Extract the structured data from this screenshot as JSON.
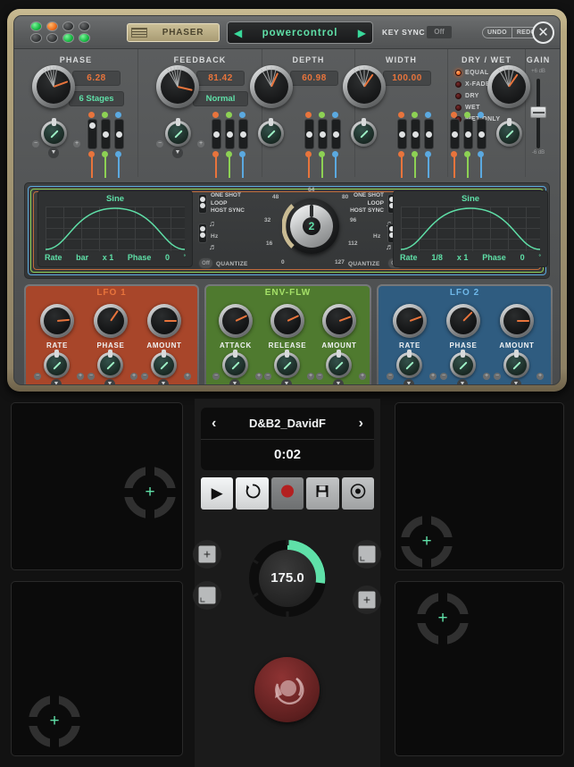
{
  "plugin": {
    "header": {
      "slot_name": "PHASER",
      "preset_name": "powercontrol",
      "prev_icon": "◀",
      "next_icon": "▶",
      "key_sync_label": "KEY SYNC",
      "key_sync_value": "Off",
      "undo_label": "UNDO",
      "redo_label": "REDO",
      "close_icon": "✕",
      "leds": [
        {
          "state": "green"
        },
        {
          "state": "orange"
        },
        {
          "state": "off"
        },
        {
          "state": "off"
        },
        {
          "state": "off"
        },
        {
          "state": "off"
        },
        {
          "state": "green"
        },
        {
          "state": "green"
        }
      ]
    },
    "params": [
      {
        "label": "PHASE",
        "value": "6.28",
        "mode": "6 Stages",
        "angle": 250
      },
      {
        "label": "FEEDBACK",
        "value": "81.42",
        "mode": "Normal",
        "angle": 283
      },
      {
        "label": "DEPTH",
        "value": "60.98",
        "mode": "",
        "angle": 205
      },
      {
        "label": "WIDTH",
        "value": "100.00",
        "mode": "",
        "angle": 215
      }
    ],
    "drywet": {
      "label": "DRY / WET",
      "options": [
        "EQUAL",
        "X-FADE",
        "DRY",
        "WET",
        "WET ONLY"
      ],
      "selected": "EQUAL"
    },
    "gain": {
      "label": "GAIN",
      "top_tick": "+6 dB",
      "bottom_tick": "-6 dB"
    },
    "lfo_display": {
      "left": {
        "wave_name": "Sine",
        "rate_label": "Rate",
        "rate_value": "bar",
        "mult": "x 1",
        "phase_label": "Phase",
        "phase_value": "0",
        "phase_unit": "°"
      },
      "right": {
        "wave_name": "Sine",
        "rate_label": "Rate",
        "rate_value": "1/8",
        "mult": "x 1",
        "phase_label": "Phase",
        "phase_value": "0",
        "phase_unit": "°"
      },
      "mode_labels": [
        "ONE SHOT",
        "LOOP",
        "HOST SYNC"
      ],
      "hz_label": "Hz",
      "quantize_label": "QUANTIZE",
      "quantize_value": "Off",
      "steps_value": "2",
      "steps_ticks": [
        "64",
        "80",
        "48",
        "96",
        "32",
        "112",
        "16",
        "127",
        "0"
      ]
    },
    "mod_sections": [
      {
        "title": "LFO 1",
        "color": "#a8462a",
        "title_color": "#e8743c",
        "knobs": [
          {
            "label": "RATE",
            "angle": 265
          },
          {
            "label": "PHASE",
            "angle": 215
          },
          {
            "label": "AMOUNT",
            "angle": 270
          }
        ]
      },
      {
        "title": "ENV-FLW",
        "color": "#4f7a2f",
        "title_color": "#a5e068",
        "knobs": [
          {
            "label": "ATTACK",
            "angle": 245
          },
          {
            "label": "RELEASE",
            "angle": 245
          },
          {
            "label": "AMOUNT",
            "angle": 250
          }
        ]
      },
      {
        "title": "LFO 2",
        "color": "#2f5c80",
        "title_color": "#6fb8e8",
        "knobs": [
          {
            "label": "RATE",
            "angle": 250
          },
          {
            "label": "PHASE",
            "angle": 225
          },
          {
            "label": "AMOUNT",
            "angle": 270
          }
        ]
      }
    ]
  },
  "host": {
    "preset": {
      "name": "D&B2_DavidF",
      "prev_icon": "‹",
      "next_icon": "›",
      "time": "0:02"
    },
    "transport": [
      {
        "name": "play",
        "glyph": "▶"
      },
      {
        "name": "loop",
        "glyph": "↻"
      },
      {
        "name": "record",
        "glyph": "●"
      },
      {
        "name": "save",
        "glyph": "Ὃe"
      },
      {
        "name": "settings",
        "glyph": "◎"
      }
    ],
    "tempo": {
      "value": "175.0",
      "arc_color": "#5fe0a8"
    },
    "side_buttons": [
      {
        "name": "add-left-top",
        "glyph": "+"
      },
      {
        "name": "loop-left-bottom",
        "glyph": ""
      },
      {
        "name": "loop-right-top",
        "glyph": ""
      },
      {
        "name": "add-right-bottom",
        "glyph": "+"
      }
    ],
    "xy_pads": [
      {
        "name": "xy-pad-top-left",
        "cx": 0.7,
        "cy": 0.53
      },
      {
        "name": "xy-pad-bottom-left",
        "cx": 0.22,
        "cy": 0.8
      },
      {
        "name": "xy-pad-top-right",
        "cx": 0.22,
        "cy": 0.78
      },
      {
        "name": "xy-pad-bottom-right",
        "cx": 0.3,
        "cy": 0.23
      }
    ],
    "record_button_label": "record-loop"
  },
  "colors": {
    "accent_green": "#5fe0a8",
    "accent_orange": "#e8743c",
    "panel_gray": "#55575 8"
  }
}
